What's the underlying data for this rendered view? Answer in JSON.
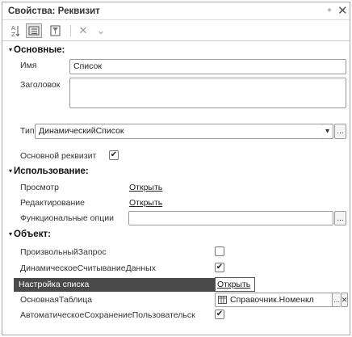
{
  "window": {
    "title": "Свойства: Реквизит"
  },
  "toolbar": {
    "sort_label": "А\nZ",
    "clear": "✕",
    "more": "⌄"
  },
  "sections": {
    "main": "Основные:",
    "usage": "Использование:",
    "object": "Объект:"
  },
  "main": {
    "name_label": "Имя",
    "name_value": "Список",
    "caption_label": "Заголовок",
    "caption_value": "",
    "type_label": "Тип",
    "type_value": "ДинамическийСписок",
    "main_attr_label": "Основной реквизит",
    "main_attr_checked": true
  },
  "usage": {
    "view_label": "Просмотр",
    "view_link": "Открыть",
    "edit_label": "Редактирование",
    "edit_link": "Открыть",
    "func_label": "Функциональные опции",
    "func_value": ""
  },
  "object": {
    "custom_query_label": "ПроизвольныйЗапрос",
    "custom_query_checked": false,
    "dynamic_read_label": "ДинамическоеСчитываниеДанных",
    "dynamic_read_checked": true,
    "list_settings_label": "Настройка списка",
    "list_settings_link": "Открыть",
    "main_table_label": "ОсновнаяТаблица",
    "main_table_value": "Справочник.Номенкл",
    "autosave_label": "АвтоматическоеСохранениеПользовательск",
    "autosave_checked": true
  },
  "glyphs": {
    "ellipsis": "...",
    "dropdown": "▾",
    "check": "✔",
    "close": "✕",
    "collapse": "▾"
  }
}
